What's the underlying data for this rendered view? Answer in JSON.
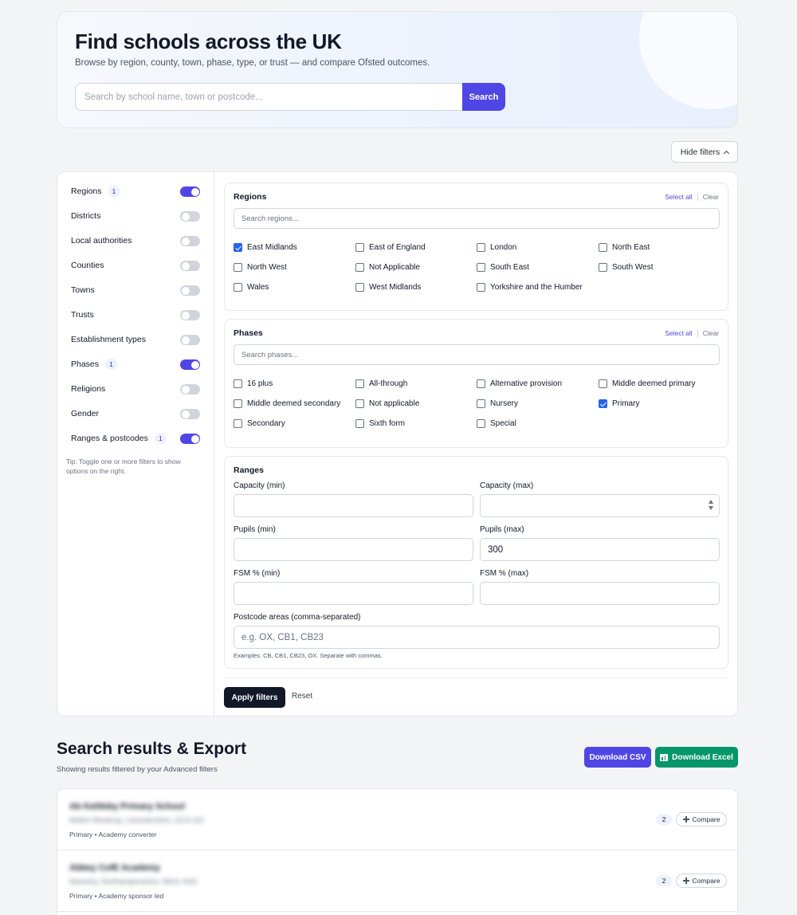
{
  "hero": {
    "title": "Find schools across the UK",
    "subtitle": "Browse by region, county, town, phase, type, or trust — and compare Ofsted outcomes.",
    "search_placeholder": "Search by school name, town or postcode...",
    "search_button": "Search"
  },
  "hide_filters_label": "Hide filters",
  "sidebar": {
    "toggles": [
      {
        "label": "Regions",
        "count": "1",
        "on": true
      },
      {
        "label": "Districts",
        "count": "",
        "on": false
      },
      {
        "label": "Local authorities",
        "count": "",
        "on": false
      },
      {
        "label": "Counties",
        "count": "",
        "on": false
      },
      {
        "label": "Towns",
        "count": "",
        "on": false
      },
      {
        "label": "Trusts",
        "count": "",
        "on": false
      },
      {
        "label": "Establishment types",
        "count": "",
        "on": false
      },
      {
        "label": "Phases",
        "count": "1",
        "on": true
      },
      {
        "label": "Religions",
        "count": "",
        "on": false
      },
      {
        "label": "Gender",
        "count": "",
        "on": false
      },
      {
        "label": "Ranges & postcodes",
        "count": "1",
        "on": true
      }
    ],
    "tip": "Tip: Toggle one or more filters to show options on the right."
  },
  "regions": {
    "title": "Regions",
    "select_all": "Select all",
    "clear": "Clear",
    "search_placeholder": "Search regions...",
    "options": [
      {
        "label": "East Midlands",
        "checked": true
      },
      {
        "label": "East of England",
        "checked": false
      },
      {
        "label": "London",
        "checked": false
      },
      {
        "label": "North East",
        "checked": false
      },
      {
        "label": "North West",
        "checked": false
      },
      {
        "label": "Not Applicable",
        "checked": false
      },
      {
        "label": "South East",
        "checked": false
      },
      {
        "label": "South West",
        "checked": false
      },
      {
        "label": "Wales",
        "checked": false
      },
      {
        "label": "West Midlands",
        "checked": false
      },
      {
        "label": "Yorkshire and the Humber",
        "checked": false
      }
    ]
  },
  "phases": {
    "title": "Phases",
    "select_all": "Select all",
    "clear": "Clear",
    "search_placeholder": "Search phases...",
    "options": [
      {
        "label": "16 plus",
        "checked": false
      },
      {
        "label": "All-through",
        "checked": false
      },
      {
        "label": "Alternative provision",
        "checked": false
      },
      {
        "label": "Middle deemed primary",
        "checked": false
      },
      {
        "label": "Middle deemed secondary",
        "checked": false
      },
      {
        "label": "Not applicable",
        "checked": false
      },
      {
        "label": "Nursery",
        "checked": false
      },
      {
        "label": "Primary",
        "checked": true
      },
      {
        "label": "Secondary",
        "checked": false
      },
      {
        "label": "Sixth form",
        "checked": false
      },
      {
        "label": "Special",
        "checked": false
      }
    ]
  },
  "ranges": {
    "title": "Ranges",
    "capacity_min_label": "Capacity (min)",
    "capacity_max_label": "Capacity (max)",
    "pupils_min_label": "Pupils (min)",
    "pupils_max_label": "Pupils (max)",
    "pupils_max_value": "300",
    "fsm_min_label": "FSM % (min)",
    "fsm_max_label": "FSM % (max)",
    "postcode_label": "Postcode areas (comma-separated)",
    "postcode_placeholder": "e.g. OX, CB1, CB23",
    "postcode_help": "Examples: CB, CB1, CB23, OX. Separate with commas."
  },
  "actions": {
    "apply": "Apply filters",
    "reset": "Reset"
  },
  "results": {
    "title": "Search results & Export",
    "subtitle": "Showing results filtered by your Advanced filters",
    "download_csv": "Download CSV",
    "download_excel": "Download Excel",
    "items": [
      {
        "name": "Ab Kettleby Primary School",
        "address": "Melton Mowbray, Leicestershire, LE14 3JJ",
        "meta": "Primary • Academy converter",
        "count": "2",
        "compare": "Compare"
      },
      {
        "name": "Abbey CofE Academy",
        "address": "Daventry, Northamptonshire, NN11 4GD",
        "meta": "Primary • Academy sponsor led",
        "count": "2",
        "compare": "Compare"
      }
    ]
  },
  "colors": {
    "accent": "#4f46e5",
    "excel": "#059669",
    "dark": "#111827"
  }
}
